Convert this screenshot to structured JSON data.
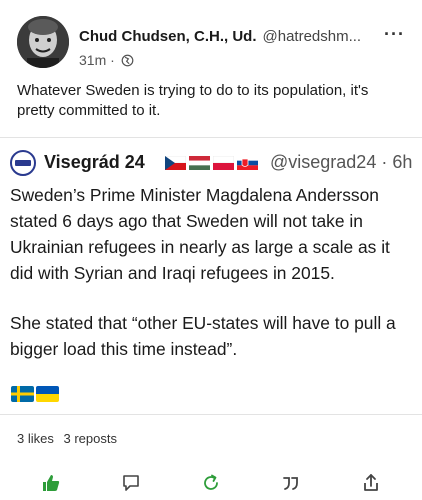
{
  "post": {
    "author": {
      "display_name": "Chud Chudsen, C.H., Ud.",
      "handle": "@hatredshm..."
    },
    "time": "31m",
    "body": "Whatever Sweden is trying to do to its population, it's pretty committed to it.",
    "more_icon": "ellipsis-icon",
    "visibility_icon": "globe-icon"
  },
  "quote": {
    "display_name": "Visegrád 24",
    "flags": [
      "czech-flag",
      "hungary-flag",
      "poland-flag",
      "slovakia-flag"
    ],
    "handle_time": "@visegrad24 · 6h",
    "paragraph_1": "Sweden’s Prime Minister Magdalena Andersson stated 6 days ago that Sweden will not take in Ukrainian refugees in nearly as large a scale as it did with Syrian and Iraqi refugees in 2015.",
    "paragraph_2": "She stated that “other EU-states will have to pull a bigger load this time instead”.",
    "emoji_flags": [
      "sweden-flag",
      "ukraine-flag"
    ]
  },
  "stats": {
    "likes": "3 likes",
    "reposts": "3 reposts"
  },
  "actions": [
    {
      "name": "like-icon",
      "color": "#2e9d3a"
    },
    {
      "name": "reply-icon",
      "color": "#444444"
    },
    {
      "name": "repost-icon",
      "color": "#2e9d3a"
    },
    {
      "name": "quote-icon",
      "color": "#444444"
    },
    {
      "name": "share-icon",
      "color": "#444444"
    }
  ],
  "colors": {
    "accent_green": "#2e9d3a",
    "divider": "#e3e3e3"
  }
}
